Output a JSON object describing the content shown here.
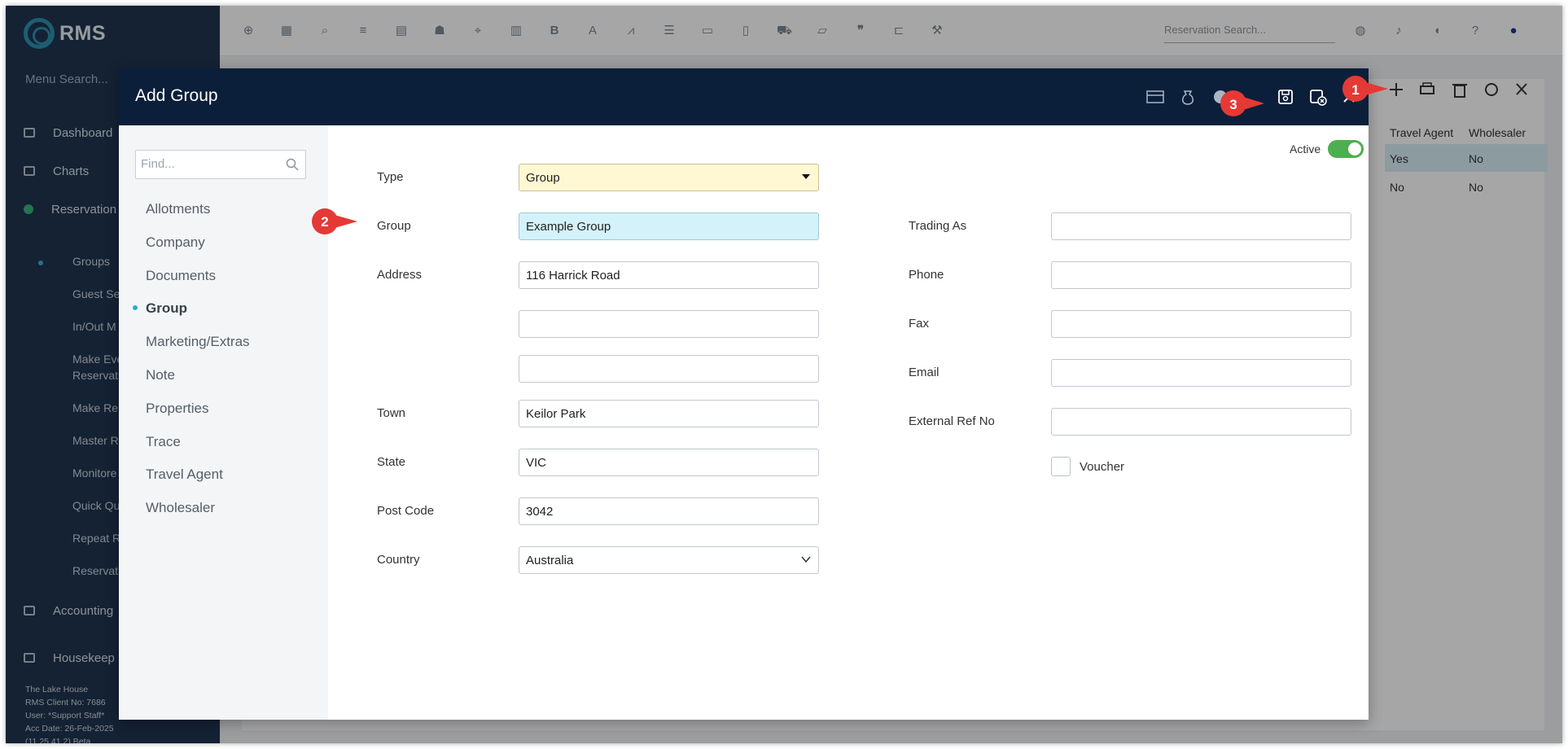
{
  "app": {
    "name": "RMS"
  },
  "sidebar": {
    "menu_search": "Menu Search...",
    "items": [
      {
        "label": "Dashboard"
      },
      {
        "label": "Charts"
      },
      {
        "label": "Reservation"
      },
      {
        "label": "Accounting"
      },
      {
        "label": "Housekeep"
      }
    ],
    "sub_items": [
      {
        "label": "Groups"
      },
      {
        "label": "Guest Se"
      },
      {
        "label": "In/Out M"
      },
      {
        "label": "Make Eve"
      },
      {
        "label": "Reservati"
      },
      {
        "label": "Make Re"
      },
      {
        "label": "Master R"
      },
      {
        "label": "Monitore"
      },
      {
        "label": "Quick Qu"
      },
      {
        "label": "Repeat R"
      },
      {
        "label": "Reservati"
      }
    ],
    "footer": {
      "property": "The Lake House",
      "client": "RMS Client No: 7686",
      "user": "User: *Support Staff*",
      "acc_date": "Acc Date: 26-Feb-2025",
      "version": "(11.25.41.2) Beta"
    }
  },
  "topbar": {
    "reservation_search_placeholder": "Reservation Search...",
    "icons": [
      "plus-circle-icon",
      "calendar-icon",
      "search-icon",
      "sliders-icon",
      "grid-icon",
      "people-icon",
      "map-pin-icon",
      "map-icon",
      "bold-icon",
      "font-icon",
      "line-chart-icon",
      "checklist-icon",
      "id-card-icon",
      "document-dollar-icon",
      "cart-icon",
      "edit-card-icon",
      "quote-icon",
      "bed-icon",
      "hammer-icon"
    ]
  },
  "list": {
    "headers": [
      "Travel Agent",
      "Wholesaler"
    ],
    "rows": [
      {
        "travel_agent": "Yes",
        "wholesaler": "No"
      },
      {
        "travel_agent": "No",
        "wholesaler": "No"
      }
    ]
  },
  "modal": {
    "title": "Add Group",
    "find_placeholder": "Find...",
    "nav": [
      {
        "label": "Allotments"
      },
      {
        "label": "Company"
      },
      {
        "label": "Documents"
      },
      {
        "label": "Group"
      },
      {
        "label": "Marketing/Extras"
      },
      {
        "label": "Note"
      },
      {
        "label": "Properties"
      },
      {
        "label": "Trace"
      },
      {
        "label": "Travel Agent"
      },
      {
        "label": "Wholesaler"
      }
    ],
    "active_label": "Active",
    "active_on": true,
    "form": {
      "type_label": "Type",
      "type_value": "Group",
      "group_label": "Group",
      "group_value": "Example Group",
      "address_label": "Address",
      "address1": "116 Harrick Road",
      "address2": "",
      "address3": "",
      "town_label": "Town",
      "town_value": "Keilor Park",
      "state_label": "State",
      "state_value": "VIC",
      "postcode_label": "Post Code",
      "postcode_value": "3042",
      "country_label": "Country",
      "country_value": "Australia",
      "trading_label": "Trading As",
      "trading_value": "",
      "phone_label": "Phone",
      "phone_value": "",
      "fax_label": "Fax",
      "fax_value": "",
      "email_label": "Email",
      "email_value": "",
      "extref_label": "External Ref No",
      "extref_value": "",
      "voucher_label": "Voucher"
    }
  },
  "callouts": [
    "1",
    "2",
    "3"
  ],
  "colors": {
    "sidebar": "#1f3550",
    "modal_header": "#0b1f3a",
    "callout": "#e53935",
    "toggle": "#4caf50",
    "type_field": "#fff8d2",
    "group_field": "#d3f2fa"
  }
}
